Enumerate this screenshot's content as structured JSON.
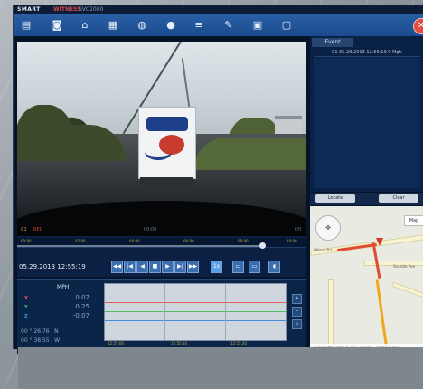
{
  "app": {
    "brand_word1": "SMART",
    "brand_word2": "WITNESS",
    "version_text": "SVC1080",
    "close_glyph": "✕"
  },
  "toolbar": {
    "items": [
      {
        "icon": "file-open-icon",
        "glyph": "▤"
      },
      {
        "icon": "camera-icon",
        "glyph": "◙"
      },
      {
        "icon": "network-icon",
        "glyph": "⌂"
      },
      {
        "icon": "folder-icon",
        "glyph": "▦"
      },
      {
        "icon": "info-icon",
        "glyph": "◍"
      },
      {
        "icon": "record-icon",
        "glyph": "●"
      },
      {
        "icon": "list-icon",
        "glyph": "≡"
      },
      {
        "icon": "wrench-icon",
        "glyph": "✎"
      },
      {
        "icon": "document-icon",
        "glyph": "▣"
      },
      {
        "icon": "chat-icon",
        "glyph": "▢"
      }
    ]
  },
  "video": {
    "hud_left": "C1",
    "hud_rec": "REC",
    "hud_mid": "00:00",
    "hud_right": "CH"
  },
  "event_panel": {
    "tab_label": "Event",
    "event_row": "01 05.29.2013 12:55:19 0 Mph"
  },
  "map": {
    "btn_left": "Locate",
    "btn_right": "Clear",
    "chip": "Map",
    "footer": "Google  Map data ©2013 Google · Terms of Use",
    "street_1": "Wilson Rd",
    "street_2": "Seaside Ave"
  },
  "controls": {
    "datetime": "05.29.2013 12:55:19",
    "timeline_ticks": [
      "00:00",
      "02:00",
      "04:00",
      "06:00",
      "08:00",
      "10:00"
    ],
    "buttons": [
      "◀◀",
      "|◀",
      "◀",
      "■",
      "▶",
      "▶|",
      "▶▶",
      "1x",
      "▭",
      "▭",
      "◖"
    ]
  },
  "gsensor": {
    "unit": "MPH",
    "x_value": "0.07",
    "y_value": "0.25",
    "z_value": "-0.07",
    "latitude": "00 ° 26.76 ' N",
    "longitude": "00 ° 38.55 ' W",
    "graph_ticks": [
      "12:55:00",
      "12:55:10",
      "12:55:20"
    ]
  },
  "colors": {
    "x_axis": "#e35b5b",
    "y_axis": "#4bbf62",
    "z_axis": "#4a8be0"
  }
}
